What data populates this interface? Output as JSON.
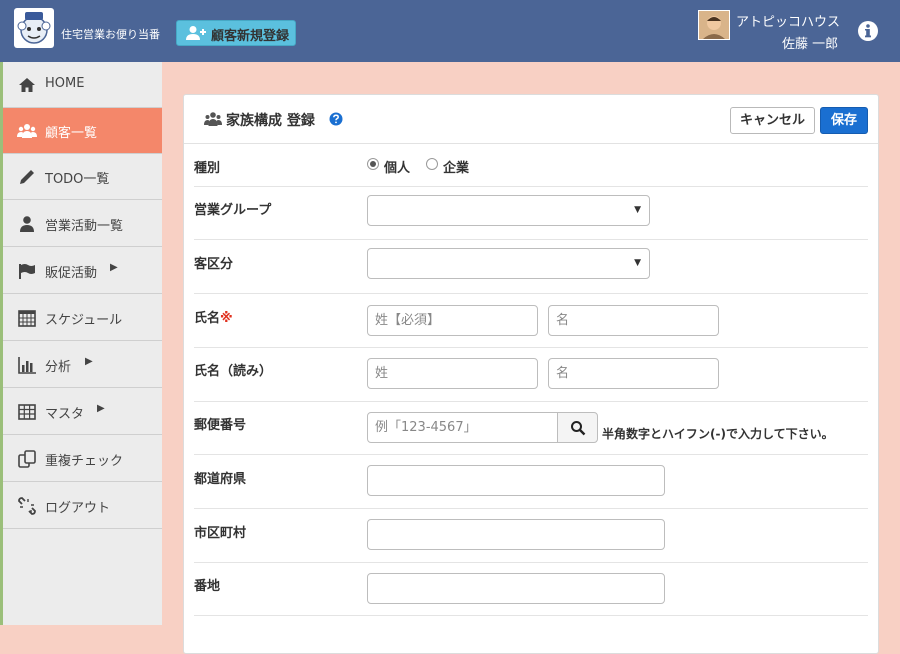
{
  "header": {
    "app_title": "住宅営業お便り当番",
    "new_customer_button": "顧客新規登録",
    "company_name": "アトピッコハウス",
    "user_name": "佐藤 一郎"
  },
  "sidebar": {
    "items": [
      {
        "label": "HOME",
        "icon": "home-icon",
        "has_arrow": false
      },
      {
        "label": "顧客一覧",
        "icon": "users-icon",
        "has_arrow": false,
        "active": true
      },
      {
        "label": "TODO一覧",
        "icon": "pencil-icon",
        "has_arrow": false
      },
      {
        "label": "営業活動一覧",
        "icon": "user-icon",
        "has_arrow": false
      },
      {
        "label": "販促活動",
        "icon": "flag-icon",
        "has_arrow": true
      },
      {
        "label": "スケジュール",
        "icon": "calendar-icon",
        "has_arrow": false
      },
      {
        "label": "分析",
        "icon": "bar-chart-icon",
        "has_arrow": true
      },
      {
        "label": "マスタ",
        "icon": "table-icon",
        "has_arrow": true
      },
      {
        "label": "重複チェック",
        "icon": "duplicate-icon",
        "has_arrow": false
      },
      {
        "label": "ログアウト",
        "icon": "unlink-icon",
        "has_arrow": false
      }
    ]
  },
  "panel": {
    "title": "家族構成 登録",
    "cancel_label": "キャンセル",
    "save_label": "保存"
  },
  "form": {
    "type": {
      "label": "種別",
      "options": [
        "個人",
        "企業"
      ],
      "selected": "個人"
    },
    "sales_group": {
      "label": "営業グループ",
      "value": ""
    },
    "customer_category": {
      "label": "客区分",
      "value": ""
    },
    "name": {
      "label": "氏名",
      "required_mark": "※",
      "last_placeholder": "姓【必須】",
      "first_placeholder": "名"
    },
    "name_kana": {
      "label": "氏名（読み）",
      "last_placeholder": "姓",
      "first_placeholder": "名"
    },
    "postal_code": {
      "label": "郵便番号",
      "placeholder": "例「123-4567」",
      "hint": "半角数字とハイフン(-)で入力して下さい。"
    },
    "prefecture": {
      "label": "都道府県",
      "value": ""
    },
    "city": {
      "label": "市区町村",
      "value": ""
    },
    "address": {
      "label": "番地",
      "value": ""
    }
  },
  "colors": {
    "header_bg": "#4b6596",
    "page_bg": "#f8d0c4",
    "active_nav": "#f4876a",
    "save_button": "#1a6fd1",
    "new_button": "#5bc0de"
  }
}
